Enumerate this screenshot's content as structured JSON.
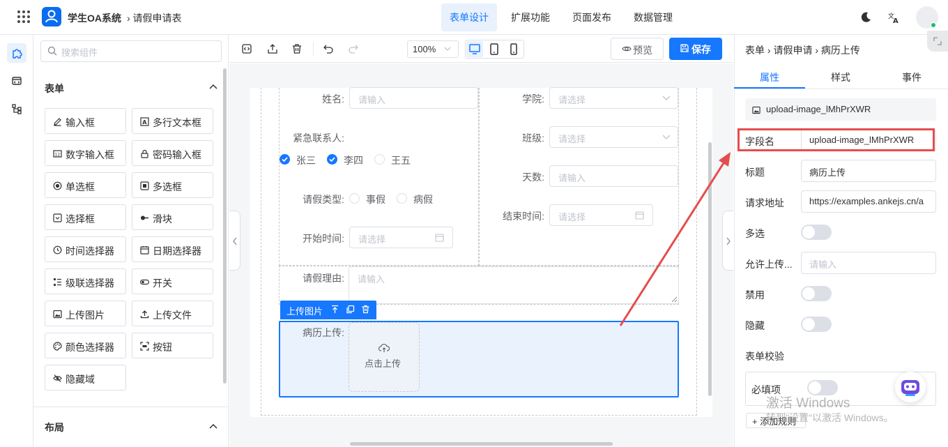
{
  "header": {
    "app_title": "学生OA系统",
    "breadcrumb": "› 请假申请表",
    "tabs": [
      {
        "label": "表单设计",
        "active": true
      },
      {
        "label": "扩展功能",
        "active": false
      },
      {
        "label": "页面发布",
        "active": false
      },
      {
        "label": "数据管理",
        "active": false
      }
    ],
    "accent_color": "#1677ff"
  },
  "component_panel": {
    "search_placeholder": "搜索组件",
    "form_section_title": "表单",
    "layout_section_title": "布局",
    "components": [
      {
        "label": "输入框",
        "icon": "pencil-icon"
      },
      {
        "label": "多行文本框",
        "icon": "textarea-icon"
      },
      {
        "label": "数字输入框",
        "icon": "number-icon"
      },
      {
        "label": "密码输入框",
        "icon": "lock-icon"
      },
      {
        "label": "单选框",
        "icon": "radio-icon"
      },
      {
        "label": "多选框",
        "icon": "checkbox-icon"
      },
      {
        "label": "选择框",
        "icon": "select-icon"
      },
      {
        "label": "滑块",
        "icon": "slider-icon"
      },
      {
        "label": "时间选择器",
        "icon": "clock-icon"
      },
      {
        "label": "日期选择器",
        "icon": "calendar-icon"
      },
      {
        "label": "级联选择器",
        "icon": "cascader-icon"
      },
      {
        "label": "开关",
        "icon": "switch-icon"
      },
      {
        "label": "上传图片",
        "icon": "image-icon"
      },
      {
        "label": "上传文件",
        "icon": "upload-icon"
      },
      {
        "label": "颜色选择器",
        "icon": "palette-icon"
      },
      {
        "label": "按钮",
        "icon": "button-icon"
      },
      {
        "label": "隐藏域",
        "icon": "eye-off-icon"
      }
    ]
  },
  "toolbar": {
    "zoom": "100%",
    "preview_label": "预览",
    "save_label": "保存"
  },
  "form": {
    "name_label": "姓名:",
    "name_placeholder": "请输入",
    "college_label": "学院:",
    "college_placeholder": "请选择",
    "contact_label": "紧急联系人:",
    "contacts": [
      {
        "label": "张三",
        "checked": true
      },
      {
        "label": "李四",
        "checked": true
      },
      {
        "label": "王五",
        "checked": false
      }
    ],
    "class_label": "班级:",
    "class_placeholder": "请选择",
    "days_label": "天数:",
    "days_placeholder": "请输入",
    "leave_type_label": "请假类型:",
    "leave_types": [
      "事假",
      "病假"
    ],
    "end_time_label": "结束时间:",
    "end_time_placeholder": "请选择",
    "start_time_label": "开始时间:",
    "start_time_placeholder": "请选择",
    "reason_label": "请假理由:",
    "reason_placeholder": "请输入",
    "selected_tag": "上传图片",
    "upload_label": "病历上传:",
    "upload_button": "点击上传"
  },
  "properties": {
    "breadcrumb": [
      "表单",
      "请假申请",
      "病历上传"
    ],
    "tabs": [
      "属性",
      "样式",
      "事件"
    ],
    "active_tab": "属性",
    "component_id": "upload-image_lMhPrXWR",
    "fields": {
      "field_name_label": "字段名",
      "field_name_value": "upload-image_lMhPrXWR",
      "title_label": "标题",
      "title_value": "病历上传",
      "url_label": "请求地址",
      "url_value": "https://examples.ankejs.cn/a",
      "multiple_label": "多选",
      "multiple_value": false,
      "allow_label": "允许上传...",
      "allow_placeholder": "请输入",
      "disabled_label": "禁用",
      "disabled_value": false,
      "hidden_label": "隐藏",
      "hidden_value": false
    },
    "validation_title": "表单校验",
    "required_label": "必填项",
    "required_value": false,
    "add_rule_label": "添加规则"
  },
  "watermark": {
    "line1": "激活 Windows",
    "line2": "转到\"设置\"以激活 Windows。"
  }
}
